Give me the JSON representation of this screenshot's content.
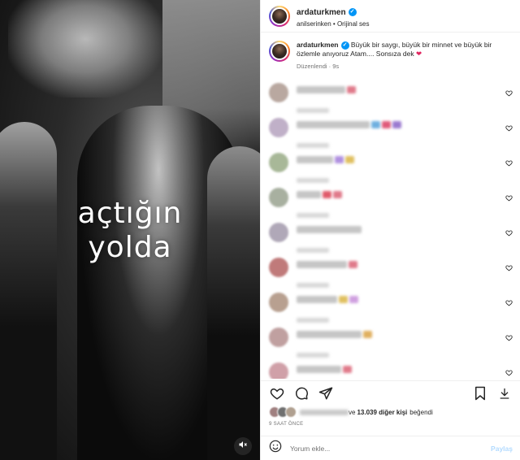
{
  "media": {
    "overlay_line1": "açtığın",
    "overlay_line2": "yolda",
    "mute_icon": "speaker-muted-icon"
  },
  "header": {
    "username": "ardaturkmen",
    "audio_label": "anilserinken • Orijinal ses",
    "verified_icon": "verified-badge-icon"
  },
  "caption": {
    "username": "ardaturkmen",
    "text": "Büyük bir saygı, büyük bir minnet ve büyük bir özlemle anıyoruz Atam.... Sonsıza dek",
    "heart": "❤",
    "edited": "Düzenlendi · 9s"
  },
  "comments": [
    {
      "avatar": "#b9a8a0",
      "text_w": 60,
      "blobs": [
        "#e07a8a"
      ]
    },
    {
      "avatar": "#c0b0c8",
      "text_w": 90,
      "blobs": [
        "#6fb0e0",
        "#e05a7a",
        "#9b7ad0"
      ]
    },
    {
      "avatar": "#a8b898",
      "text_w": 45,
      "blobs": [
        "#b090e0",
        "#e0c060"
      ]
    },
    {
      "avatar": "#a8b0a0",
      "text_w": 30,
      "blobs": [
        "#e05a6a",
        "#e07a8a"
      ]
    },
    {
      "avatar": "#b0a8b8",
      "text_w": 80,
      "blobs": []
    },
    {
      "avatar": "#c07a7a",
      "text_w": 62,
      "blobs": [
        "#e07a8a"
      ]
    },
    {
      "avatar": "#b8a090",
      "text_w": 50,
      "blobs": [
        "#e0c060",
        "#d0a0e0"
      ]
    },
    {
      "avatar": "#c0a0a0",
      "text_w": 80,
      "blobs": [
        "#e0b060"
      ]
    },
    {
      "avatar": "#d0a0a8",
      "text_w": 55,
      "blobs": [
        "#e07a8a"
      ]
    }
  ],
  "actions": {
    "like_icon": "heart-icon",
    "comment_icon": "comment-bubble-icon",
    "share_icon": "paper-plane-icon",
    "save_icon": "bookmark-icon",
    "download_icon": "download-icon"
  },
  "likes": {
    "count": "13.039 diğer kişi",
    "suffix": "beğendi",
    "prefix": "ve"
  },
  "time": "9 SAAT ÖNCE",
  "comment_bar": {
    "emoji_icon": "smiley-icon",
    "placeholder": "Yorum ekle...",
    "post_label": "Paylaş"
  }
}
